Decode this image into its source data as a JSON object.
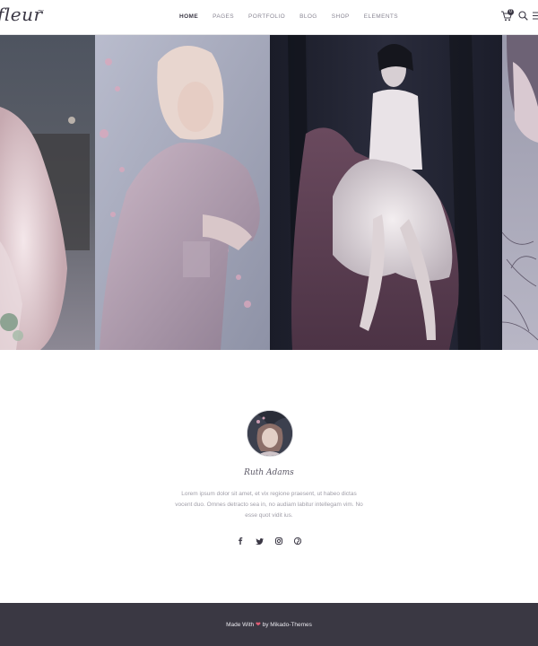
{
  "header": {
    "logo_text": "fleur",
    "nav": [
      "HOME",
      "PAGES",
      "PORTFOLIO",
      "BLOG",
      "SHOP",
      "ELEMENTS"
    ],
    "cart_count": "0",
    "icons": [
      "cart-icon",
      "search-icon",
      "menu-icon"
    ]
  },
  "gallery": {
    "panels": 4
  },
  "profile": {
    "name": "Ruth Adams",
    "bio": "Lorem ipsum dolor sit amet, et vix regione praesent, ut habeo dictas vocent duo. Omnes detracto sea in, no audiam labitur intellegam vim. No esse quot vidit ius.",
    "socials": [
      "facebook-icon",
      "twitter-icon",
      "instagram-icon",
      "pinterest-icon"
    ]
  },
  "footer": {
    "text_before": "Made With",
    "text_after": "by Mikado-Themes"
  },
  "colors": {
    "dark": "#3a3843",
    "accent_heart": "#e35d76",
    "nav_active": "#3b3845",
    "nav_inactive": "#8a8794"
  }
}
